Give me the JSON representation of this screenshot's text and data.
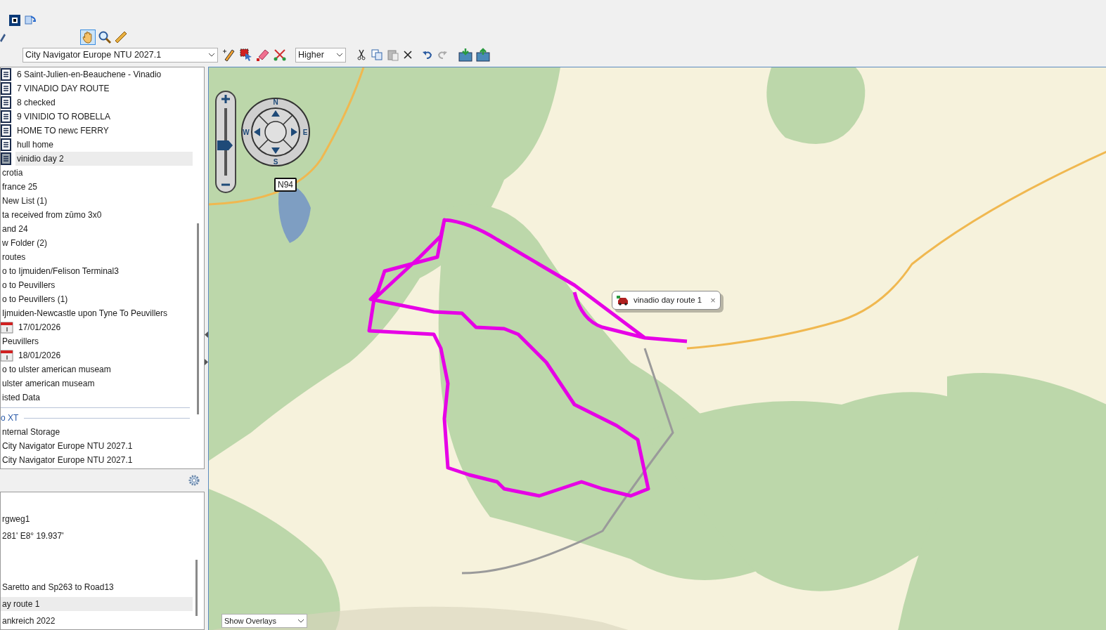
{
  "map_source": {
    "value": "City Navigator Europe NTU 2027.1"
  },
  "detail": {
    "value": "Higher"
  },
  "library": [
    {
      "kind": "route",
      "label": "6 Saint-Julien-en-Beauchene - Vinadio",
      "selected": false
    },
    {
      "kind": "route",
      "label": "7 VINADIO DAY ROUTE",
      "selected": false
    },
    {
      "kind": "route",
      "label": "8 checked",
      "selected": false
    },
    {
      "kind": "route",
      "label": "9 VINIDIO TO ROBELLA",
      "selected": false
    },
    {
      "kind": "route",
      "label": "HOME TO  newc FERRY",
      "selected": false
    },
    {
      "kind": "route",
      "label": "hull home",
      "selected": false
    },
    {
      "kind": "route",
      "label": "vinidio day 2",
      "selected": true
    },
    {
      "kind": "text",
      "label": "crotia",
      "selected": false
    },
    {
      "kind": "text",
      "label": "france 25",
      "selected": false
    },
    {
      "kind": "text",
      "label": "New List (1)",
      "selected": false
    },
    {
      "kind": "text",
      "label": "ta received from zūmo 3x0",
      "selected": false
    },
    {
      "kind": "text",
      "label": "and 24",
      "selected": false
    },
    {
      "kind": "text",
      "label": "w Folder (2)",
      "selected": false
    },
    {
      "kind": "text",
      "label": "routes",
      "selected": false
    },
    {
      "kind": "text",
      "label": "o to Ijmuiden/Felison Terminal3",
      "selected": false
    },
    {
      "kind": "text",
      "label": "o to Peuvillers",
      "selected": false
    },
    {
      "kind": "text",
      "label": "o to Peuvillers (1)",
      "selected": false
    },
    {
      "kind": "text",
      "label": "Ijmuiden-Newcastle upon Tyne To Peuvillers",
      "selected": false
    },
    {
      "kind": "date",
      "label": "17/01/2026",
      "selected": false
    },
    {
      "kind": "text",
      "label": "Peuvillers",
      "selected": false
    },
    {
      "kind": "date",
      "label": "18/01/2026",
      "selected": false
    },
    {
      "kind": "text",
      "label": "o to ulster american museam",
      "selected": false
    },
    {
      "kind": "text",
      "label": "ulster american museam",
      "selected": false
    },
    {
      "kind": "text",
      "label": "isted Data",
      "selected": false
    },
    {
      "kind": "separator"
    },
    {
      "kind": "header",
      "label": "o XT"
    },
    {
      "kind": "text",
      "label": "nternal Storage",
      "selected": false
    },
    {
      "kind": "text",
      "label": "City Navigator Europe NTU 2027.1",
      "selected": false
    },
    {
      "kind": "text",
      "label": "City Navigator Europe NTU 2027.1",
      "selected": false
    }
  ],
  "details": [
    {
      "kind": "text",
      "label": "rgweg1",
      "selected": false
    },
    {
      "kind": "text",
      "label": "281' E8° 19.937'",
      "selected": false
    },
    {
      "kind": "gap"
    },
    {
      "kind": "gap"
    },
    {
      "kind": "text",
      "label": "Saretto and  Sp263 to Road13",
      "selected": false
    },
    {
      "kind": "text",
      "label": "ay route 1",
      "selected": true
    },
    {
      "kind": "text",
      "label": "ankreich 2022",
      "selected": false
    }
  ],
  "compass": {
    "north": "N",
    "east": "E",
    "south": "S",
    "west": "W"
  },
  "zoom": {
    "level": 0.45
  },
  "road_shield": "N94",
  "callout": {
    "label": "vinadio day route 1",
    "close": "×"
  },
  "overlays": {
    "value": "Show Overlays"
  }
}
